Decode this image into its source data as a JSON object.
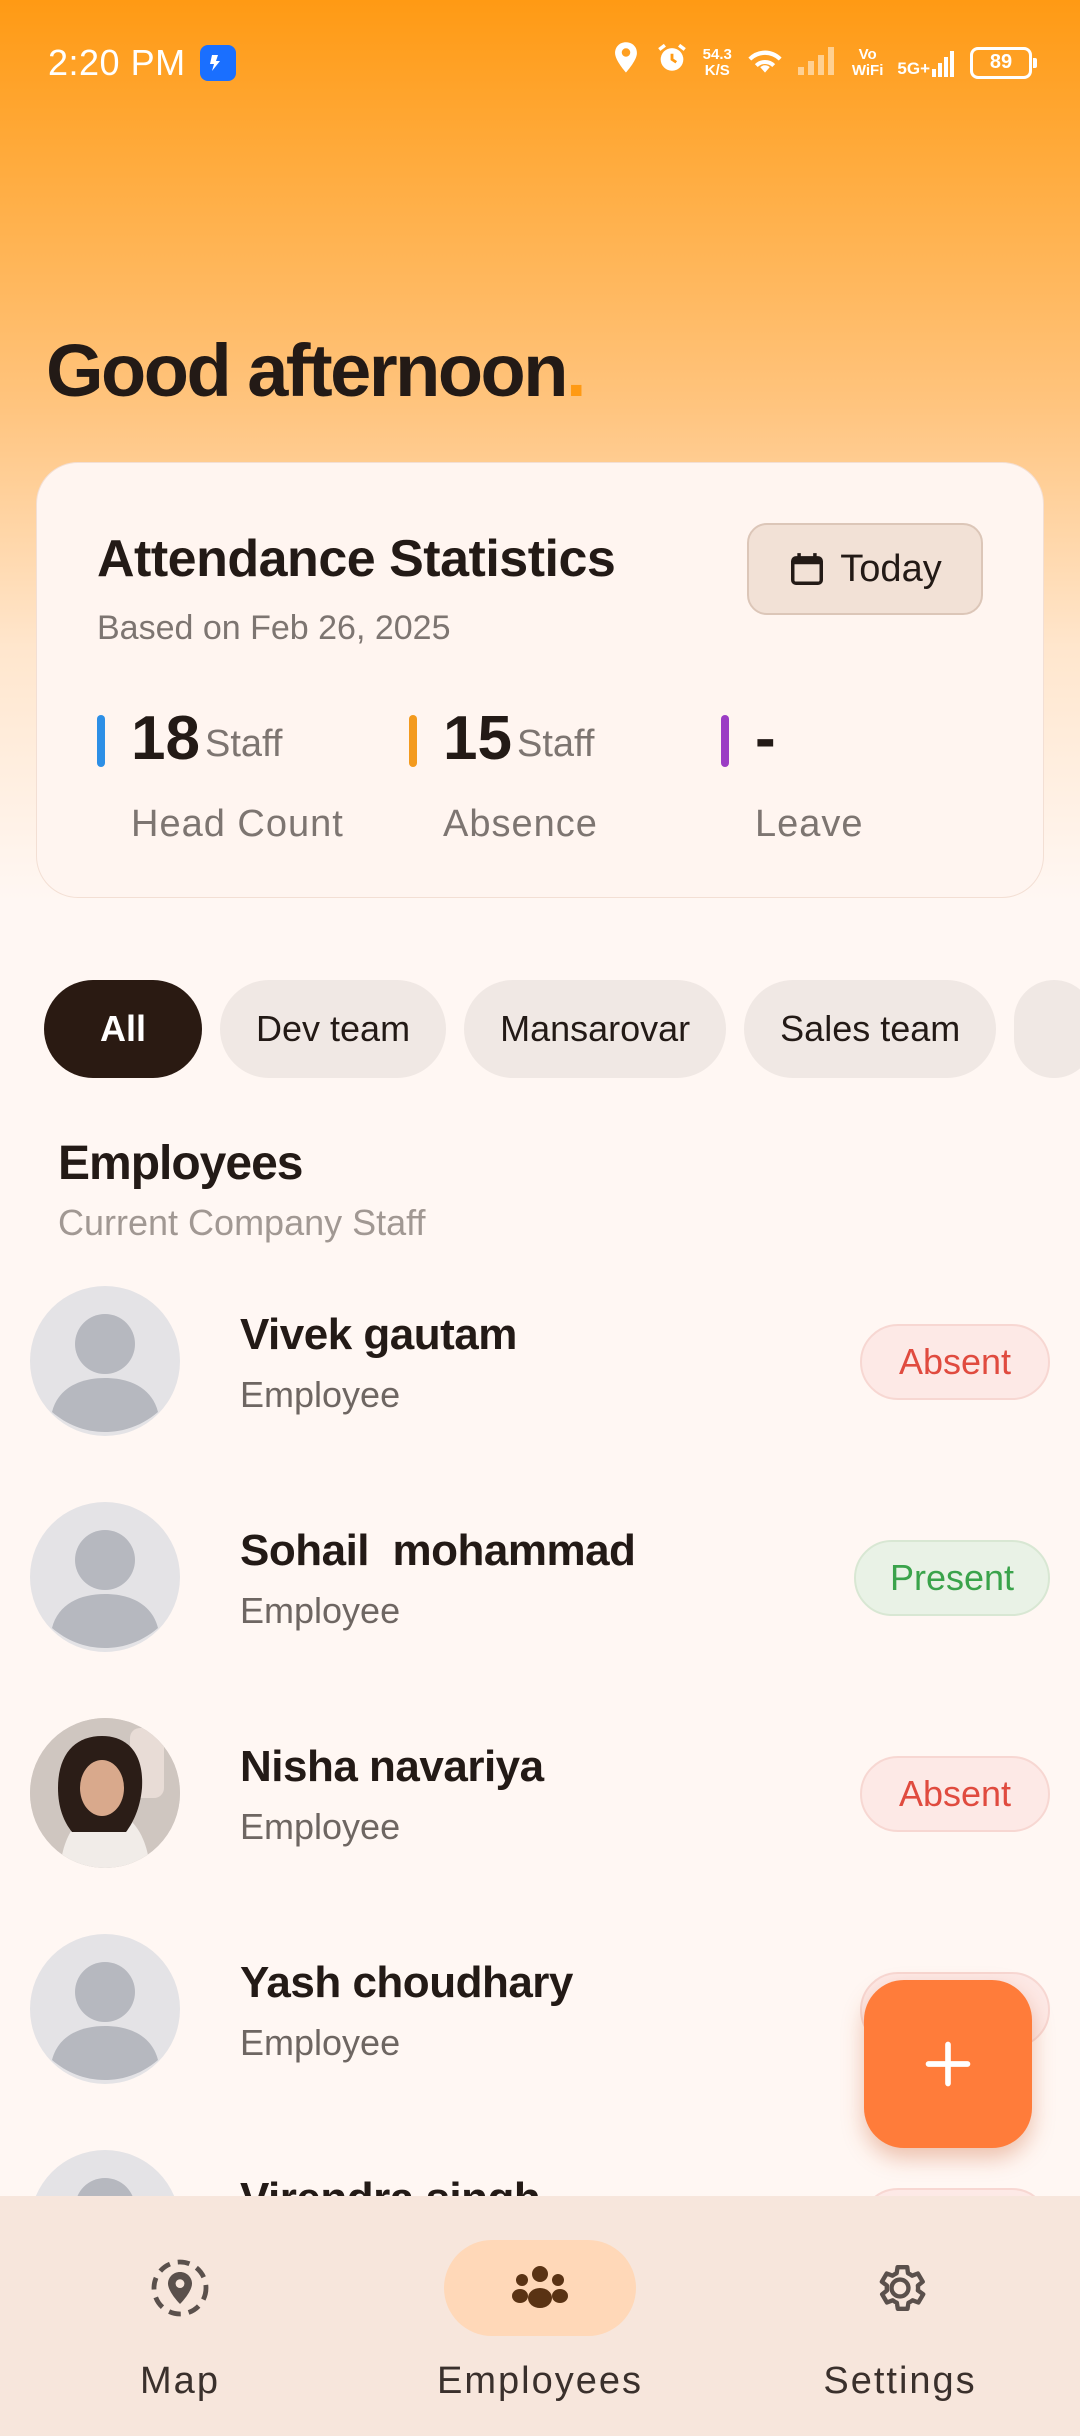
{
  "status_bar": {
    "time": "2:20 PM",
    "speed_value": "54.3",
    "speed_unit": "K/S",
    "network_label_top": "Vo",
    "network_label_bottom": "WiFi",
    "network_type": "5G+",
    "battery": "89"
  },
  "greeting": {
    "text": "Good afternoon",
    "dot": "."
  },
  "stats": {
    "title": "Attendance Statistics",
    "subtitle": "Based on Feb 26, 2025",
    "date_button": "Today",
    "items": [
      {
        "value": "18",
        "unit": "Staff",
        "label": "Head Count",
        "color": "#2d8fe6"
      },
      {
        "value": "15",
        "unit": "Staff",
        "label": "Absence",
        "color": "#f39a1e"
      },
      {
        "value": "-",
        "unit": "",
        "label": "Leave",
        "color": "#9b3cc4"
      }
    ]
  },
  "filters": [
    "All",
    "Dev team",
    "Mansarovar",
    "Sales team"
  ],
  "employees_section": {
    "title": "Employees",
    "subtitle": "Current Company Staff"
  },
  "employees": [
    {
      "name": "Vivek gautam",
      "role": "Employee",
      "status": "Absent"
    },
    {
      "name": "Sohail  mohammad",
      "role": "Employee",
      "status": "Present"
    },
    {
      "name": "Nisha navariya",
      "role": "Employee",
      "status": "Absent"
    },
    {
      "name": "Yash choudhary",
      "role": "Employee",
      "status": ""
    },
    {
      "name": "Virendra singh",
      "role": "",
      "status": ""
    }
  ],
  "bottom_nav": [
    {
      "label": "Map",
      "icon": "map-pin-icon"
    },
    {
      "label": "Employees",
      "icon": "people-icon",
      "active": true
    },
    {
      "label": "Settings",
      "icon": "gear-icon"
    }
  ],
  "colors": {
    "accent": "#ff9a14",
    "fab": "#ff7c3a",
    "absent": "#e04b3f",
    "present": "#3aa34b"
  }
}
